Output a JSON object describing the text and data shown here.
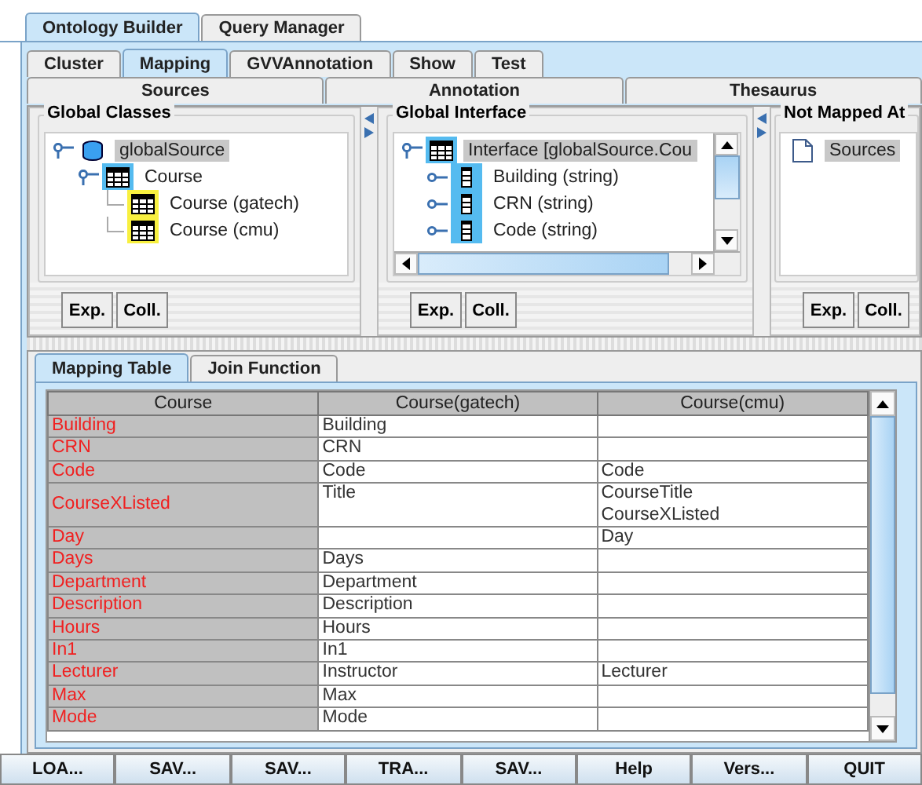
{
  "main_tabs": [
    {
      "label": "Ontology Builder",
      "selected": true
    },
    {
      "label": "Query Manager",
      "selected": false
    }
  ],
  "sub_tabs": [
    {
      "label": "Cluster",
      "selected": false
    },
    {
      "label": "Mapping",
      "selected": true
    },
    {
      "label": "GVVAnnotation",
      "selected": false
    },
    {
      "label": "Show",
      "selected": false
    },
    {
      "label": "Test",
      "selected": false
    }
  ],
  "sub_tabs_row2": [
    {
      "label": "Sources",
      "selected": false
    },
    {
      "label": "Annotation",
      "selected": false
    },
    {
      "label": "Thesaurus",
      "selected": false
    }
  ],
  "panels": [
    {
      "title": "Global Classes",
      "scrollbars": false,
      "tree": [
        {
          "label": "globalSource",
          "kind": "database",
          "color": "#ffffff",
          "selected": true,
          "expanded": true,
          "children": [
            {
              "label": "Course",
              "kind": "table",
              "color": "#55bbf0",
              "selected": false,
              "expanded": true,
              "children": [
                {
                  "label": "Course (gatech)",
                  "kind": "table",
                  "color": "#f8f040",
                  "selected": false
                },
                {
                  "label": "Course (cmu)",
                  "kind": "table",
                  "color": "#f8f040",
                  "selected": false
                }
              ]
            }
          ]
        }
      ],
      "buttons": [
        "Exp.",
        "Coll."
      ]
    },
    {
      "title": "Global Interface",
      "scrollbars": true,
      "tree": [
        {
          "label": "Interface [globalSource.Cou",
          "kind": "table",
          "color": "#55bbf0",
          "selected": true,
          "expanded": true,
          "children": [
            {
              "label": "Building (string)",
              "kind": "field",
              "color": "#55bbf0",
              "selected": false,
              "expanded": false
            },
            {
              "label": "CRN (string)",
              "kind": "field",
              "color": "#55bbf0",
              "selected": false,
              "expanded": false
            },
            {
              "label": "Code (string)",
              "kind": "field",
              "color": "#55bbf0",
              "selected": false,
              "expanded": false
            }
          ]
        }
      ],
      "buttons": [
        "Exp.",
        "Coll."
      ]
    },
    {
      "title": "Not Mapped At",
      "scrollbars": false,
      "tree": [
        {
          "label": "Sources",
          "kind": "document",
          "color": "#ffffff",
          "selected": true
        }
      ],
      "buttons": [
        "Exp.",
        "Coll."
      ]
    }
  ],
  "lower_tabs": [
    {
      "label": "Mapping Table",
      "selected": true
    },
    {
      "label": "Join Function",
      "selected": false
    }
  ],
  "table": {
    "columns": [
      "Course",
      "Course(gatech)",
      "Course(cmu)"
    ],
    "rows": [
      {
        "name": "Building",
        "gatech": [
          "Building"
        ],
        "cmu": []
      },
      {
        "name": "CRN",
        "gatech": [
          "CRN"
        ],
        "cmu": []
      },
      {
        "name": "Code",
        "gatech": [
          "Code"
        ],
        "cmu": [
          "Code"
        ]
      },
      {
        "name": "CourseXListed",
        "gatech": [
          "Title"
        ],
        "cmu": [
          "CourseTitle",
          "CourseXListed"
        ]
      },
      {
        "name": "Day",
        "gatech": [],
        "cmu": [
          "Day"
        ]
      },
      {
        "name": "Days",
        "gatech": [
          "Days"
        ],
        "cmu": []
      },
      {
        "name": "Department",
        "gatech": [
          "Department"
        ],
        "cmu": []
      },
      {
        "name": "Description",
        "gatech": [
          "Description"
        ],
        "cmu": []
      },
      {
        "name": "Hours",
        "gatech": [
          "Hours"
        ],
        "cmu": []
      },
      {
        "name": "In1",
        "gatech": [
          "In1"
        ],
        "cmu": []
      },
      {
        "name": "Lecturer",
        "gatech": [
          "Instructor"
        ],
        "cmu": [
          "Lecturer"
        ]
      },
      {
        "name": "Max",
        "gatech": [
          "Max"
        ],
        "cmu": []
      },
      {
        "name": "Mode",
        "gatech": [
          "Mode"
        ],
        "cmu": []
      }
    ]
  },
  "bottom_buttons": [
    "LOA...",
    "SAV...",
    "SAV...",
    "TRA...",
    "SAV...",
    "Help",
    "Vers...",
    "QUIT"
  ]
}
